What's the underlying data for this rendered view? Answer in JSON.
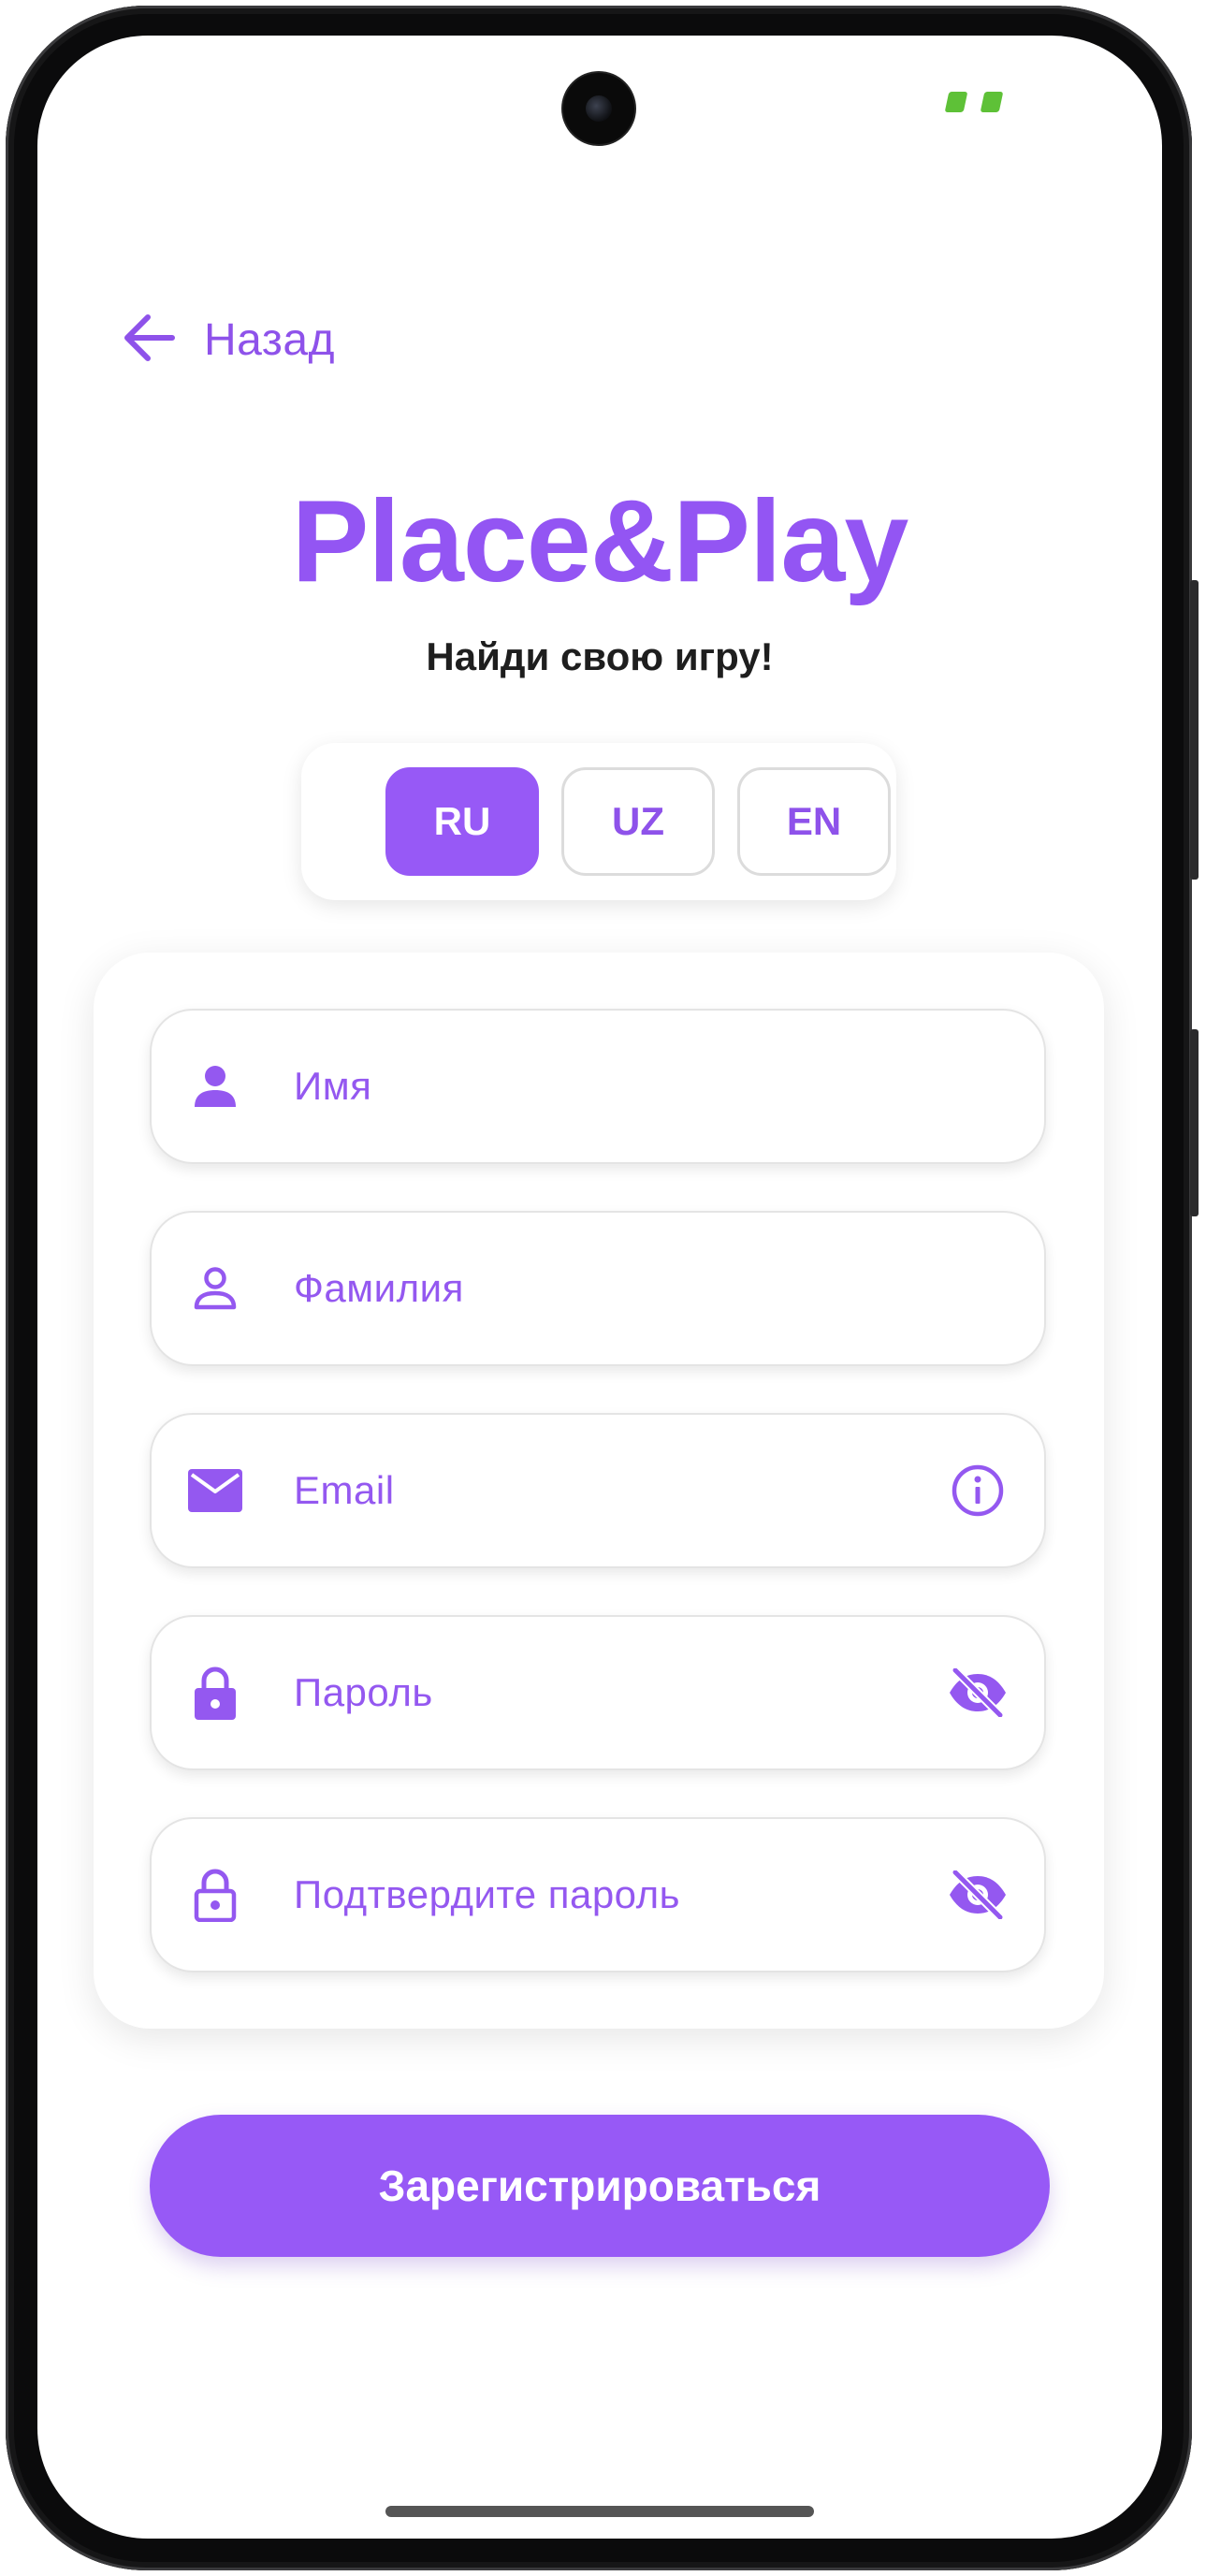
{
  "app": {
    "back_label": "Назад",
    "title": "Place&Play",
    "tagline": "Найди свою игру!"
  },
  "languages": [
    {
      "code": "RU",
      "active": true
    },
    {
      "code": "UZ",
      "active": false
    },
    {
      "code": "EN",
      "active": false
    }
  ],
  "form": {
    "first_name": {
      "placeholder": "Имя",
      "value": "",
      "icon": "person-filled-icon"
    },
    "last_name": {
      "placeholder": "Фамилия",
      "value": "",
      "icon": "person-outline-icon"
    },
    "email": {
      "placeholder": "Email",
      "value": "",
      "icon": "mail-icon",
      "trailing_icon": "info-icon"
    },
    "password": {
      "placeholder": "Пароль",
      "value": "",
      "icon": "lock-filled-icon",
      "trailing_icon": "eye-off-icon"
    },
    "confirm_password": {
      "placeholder": "Подтвердите пароль",
      "value": "",
      "icon": "lock-outline-icon",
      "trailing_icon": "eye-off-icon"
    }
  },
  "submit_label": "Зарегистрироваться",
  "colors": {
    "accent": "#9759f6",
    "accent_text": "#8e52ea",
    "tagline": "#1e1e1e",
    "status_indicator": "#5ec137"
  }
}
